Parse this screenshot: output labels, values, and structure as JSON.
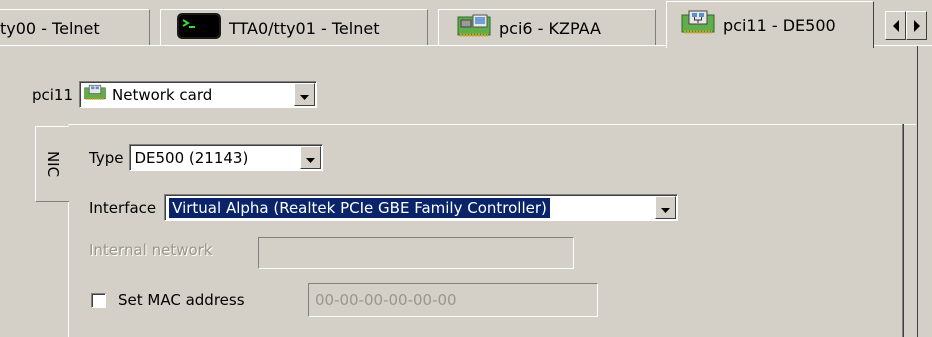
{
  "tabs": [
    {
      "label": "ty00 - Telnet",
      "icon": "none"
    },
    {
      "label": "TTA0/tty01 - Telnet",
      "icon": "terminal-icon"
    },
    {
      "label": "pci6 - KZPAA",
      "icon": "scsi-card-icon"
    },
    {
      "label": "pci11 - DE500",
      "icon": "network-card-icon",
      "active": true
    }
  ],
  "device": {
    "label": "pci11",
    "type_value": "Network card",
    "type_icon": "network-card-icon"
  },
  "nic": {
    "tab_label": "NIC",
    "type_label": "Type",
    "type_value": "DE500 (21143)",
    "interface_label": "Interface",
    "interface_value": "Virtual Alpha (Realtek PCIe GBE Family Controller)",
    "internal_network_label": "Internal network",
    "internal_network_value": "",
    "set_mac_label": "Set MAC address",
    "set_mac_checked": false,
    "mac_value": "00-00-00-00-00-00"
  },
  "colors": {
    "window_bg": "#d4d0c8",
    "selection_bg": "#0a246a",
    "disabled_text": "#9a968c"
  }
}
